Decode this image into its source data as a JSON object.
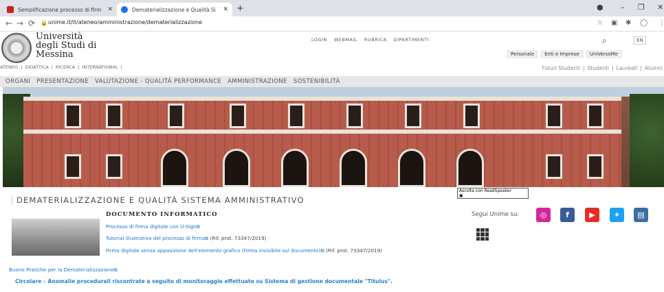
{
  "browser": {
    "tabs": [
      {
        "title": "Semplificazione processo di firm",
        "active": false,
        "favicon_color": "#c5221f"
      },
      {
        "title": "Dematerializzazione e Qualità Si",
        "active": true,
        "favicon_color": "#1a73e8"
      }
    ],
    "url": "unime.it/it/ateneo/amministrazione/dematerializzazione"
  },
  "header": {
    "university_name": [
      "Università",
      "degli Studi di",
      "Messina"
    ],
    "top_links": [
      "LOGIN",
      "WEBMAIL",
      "RUBRICA",
      "DIPARTIMENTI"
    ],
    "lang_label": "EN",
    "audience_tabs": [
      "Personale",
      "Enti e Imprese",
      "UniVersoMe"
    ]
  },
  "subnav": {
    "left": [
      "ATENEO",
      "DIDATTICA",
      "RICERCA",
      "INTERNATIONAL"
    ],
    "right": [
      "Futuri Studenti",
      "Studenti",
      "Laureati",
      "Alumni"
    ]
  },
  "main_nav": [
    "ORGANI",
    "PRESENTAZIONE",
    "VALUTAZIONE - QUALITÀ PERFORMANCE",
    "AMMINISTRAZIONE",
    "SOSTENIBILITÀ"
  ],
  "readspeaker_label": "Ascolta con ReadSpeaker",
  "page_title": "DEMATERIALIZZAZIONE E QUALITÀ SISTEMA AMMINISTRATIVO",
  "document": {
    "heading": "DOCUMENTO INFORMATICO",
    "links": [
      {
        "text": "Processo di firma digitale con U-Sign",
        "ref": ""
      },
      {
        "text": "Tutorial illustrativo del processo di firma",
        "ref": "(Rif. prot. 73347/2019)"
      },
      {
        "text": "Firma digitale senza apposizione dell'elemento grafico (Firma invisibile sul documento)",
        "ref": "(Rif. prot. 73347/2019)"
      }
    ]
  },
  "buone_pratiche": "Buone Pratiche per la Dematerializzazione",
  "circolare": "Circolare – Anomalie procedurali riscontrate a seguito di monitoraggio effettuato su Sistema di gestione documentale \"Titulus\".",
  "social": {
    "label": "Segui Unime su:",
    "icons": [
      {
        "name": "instagram",
        "color": "#d6249f"
      },
      {
        "name": "facebook",
        "color": "#3b5998"
      },
      {
        "name": "youtube",
        "color": "#e52d27"
      },
      {
        "name": "twitter",
        "color": "#1da1f2"
      },
      {
        "name": "app",
        "color": "#3a6ea5"
      }
    ]
  }
}
